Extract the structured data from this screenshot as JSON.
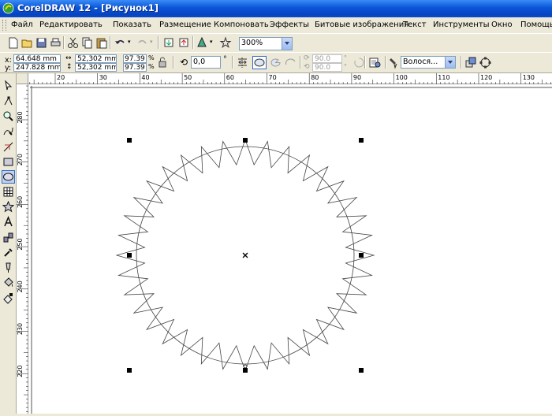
{
  "window": {
    "title": "CorelDRAW 12 - [Рисунок1]"
  },
  "menu": [
    "Файл",
    "Редактировать",
    "Показать",
    "Размещение",
    "Компоновать",
    "Эффекты",
    "Битовые изображения",
    "Текст",
    "Инструменты",
    "Окно",
    "Помощь"
  ],
  "toolbar": {
    "zoom": "300%"
  },
  "property_bar": {
    "x": "64.648 mm",
    "y": "247.828 mm",
    "width": "52,302 mm",
    "height": "52,302 mm",
    "scale_x": "97.39",
    "scale_y": "97.39",
    "percent": "%",
    "rotation": "0,0",
    "degree": "°",
    "start_angle": "90.0",
    "end_angle": "90.0",
    "outline": "Волося..."
  },
  "ruler": {
    "top_labels": [
      "20",
      "30",
      "40",
      "50",
      "60",
      "70",
      "80",
      "90",
      "100",
      "110",
      "120",
      "130"
    ],
    "left_labels": [
      "280",
      "270",
      "260",
      "250",
      "240",
      "230",
      "220"
    ]
  },
  "colors": {
    "title_bar": "#0a55d8",
    "chrome": "#ece9d8",
    "canvas": "#ffffff",
    "selection": "#000000"
  }
}
